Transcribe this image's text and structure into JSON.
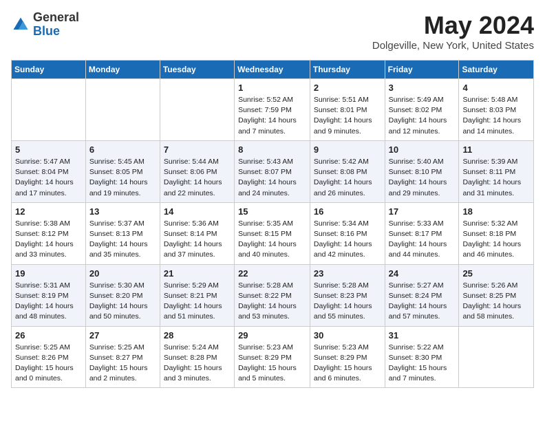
{
  "header": {
    "logo_general": "General",
    "logo_blue": "Blue",
    "month_title": "May 2024",
    "location": "Dolgeville, New York, United States"
  },
  "days_of_week": [
    "Sunday",
    "Monday",
    "Tuesday",
    "Wednesday",
    "Thursday",
    "Friday",
    "Saturday"
  ],
  "weeks": [
    [
      {
        "day": "",
        "info": ""
      },
      {
        "day": "",
        "info": ""
      },
      {
        "day": "",
        "info": ""
      },
      {
        "day": "1",
        "info": "Sunrise: 5:52 AM\nSunset: 7:59 PM\nDaylight: 14 hours\nand 7 minutes."
      },
      {
        "day": "2",
        "info": "Sunrise: 5:51 AM\nSunset: 8:01 PM\nDaylight: 14 hours\nand 9 minutes."
      },
      {
        "day": "3",
        "info": "Sunrise: 5:49 AM\nSunset: 8:02 PM\nDaylight: 14 hours\nand 12 minutes."
      },
      {
        "day": "4",
        "info": "Sunrise: 5:48 AM\nSunset: 8:03 PM\nDaylight: 14 hours\nand 14 minutes."
      }
    ],
    [
      {
        "day": "5",
        "info": "Sunrise: 5:47 AM\nSunset: 8:04 PM\nDaylight: 14 hours\nand 17 minutes."
      },
      {
        "day": "6",
        "info": "Sunrise: 5:45 AM\nSunset: 8:05 PM\nDaylight: 14 hours\nand 19 minutes."
      },
      {
        "day": "7",
        "info": "Sunrise: 5:44 AM\nSunset: 8:06 PM\nDaylight: 14 hours\nand 22 minutes."
      },
      {
        "day": "8",
        "info": "Sunrise: 5:43 AM\nSunset: 8:07 PM\nDaylight: 14 hours\nand 24 minutes."
      },
      {
        "day": "9",
        "info": "Sunrise: 5:42 AM\nSunset: 8:08 PM\nDaylight: 14 hours\nand 26 minutes."
      },
      {
        "day": "10",
        "info": "Sunrise: 5:40 AM\nSunset: 8:10 PM\nDaylight: 14 hours\nand 29 minutes."
      },
      {
        "day": "11",
        "info": "Sunrise: 5:39 AM\nSunset: 8:11 PM\nDaylight: 14 hours\nand 31 minutes."
      }
    ],
    [
      {
        "day": "12",
        "info": "Sunrise: 5:38 AM\nSunset: 8:12 PM\nDaylight: 14 hours\nand 33 minutes."
      },
      {
        "day": "13",
        "info": "Sunrise: 5:37 AM\nSunset: 8:13 PM\nDaylight: 14 hours\nand 35 minutes."
      },
      {
        "day": "14",
        "info": "Sunrise: 5:36 AM\nSunset: 8:14 PM\nDaylight: 14 hours\nand 37 minutes."
      },
      {
        "day": "15",
        "info": "Sunrise: 5:35 AM\nSunset: 8:15 PM\nDaylight: 14 hours\nand 40 minutes."
      },
      {
        "day": "16",
        "info": "Sunrise: 5:34 AM\nSunset: 8:16 PM\nDaylight: 14 hours\nand 42 minutes."
      },
      {
        "day": "17",
        "info": "Sunrise: 5:33 AM\nSunset: 8:17 PM\nDaylight: 14 hours\nand 44 minutes."
      },
      {
        "day": "18",
        "info": "Sunrise: 5:32 AM\nSunset: 8:18 PM\nDaylight: 14 hours\nand 46 minutes."
      }
    ],
    [
      {
        "day": "19",
        "info": "Sunrise: 5:31 AM\nSunset: 8:19 PM\nDaylight: 14 hours\nand 48 minutes."
      },
      {
        "day": "20",
        "info": "Sunrise: 5:30 AM\nSunset: 8:20 PM\nDaylight: 14 hours\nand 50 minutes."
      },
      {
        "day": "21",
        "info": "Sunrise: 5:29 AM\nSunset: 8:21 PM\nDaylight: 14 hours\nand 51 minutes."
      },
      {
        "day": "22",
        "info": "Sunrise: 5:28 AM\nSunset: 8:22 PM\nDaylight: 14 hours\nand 53 minutes."
      },
      {
        "day": "23",
        "info": "Sunrise: 5:28 AM\nSunset: 8:23 PM\nDaylight: 14 hours\nand 55 minutes."
      },
      {
        "day": "24",
        "info": "Sunrise: 5:27 AM\nSunset: 8:24 PM\nDaylight: 14 hours\nand 57 minutes."
      },
      {
        "day": "25",
        "info": "Sunrise: 5:26 AM\nSunset: 8:25 PM\nDaylight: 14 hours\nand 58 minutes."
      }
    ],
    [
      {
        "day": "26",
        "info": "Sunrise: 5:25 AM\nSunset: 8:26 PM\nDaylight: 15 hours\nand 0 minutes."
      },
      {
        "day": "27",
        "info": "Sunrise: 5:25 AM\nSunset: 8:27 PM\nDaylight: 15 hours\nand 2 minutes."
      },
      {
        "day": "28",
        "info": "Sunrise: 5:24 AM\nSunset: 8:28 PM\nDaylight: 15 hours\nand 3 minutes."
      },
      {
        "day": "29",
        "info": "Sunrise: 5:23 AM\nSunset: 8:29 PM\nDaylight: 15 hours\nand 5 minutes."
      },
      {
        "day": "30",
        "info": "Sunrise: 5:23 AM\nSunset: 8:29 PM\nDaylight: 15 hours\nand 6 minutes."
      },
      {
        "day": "31",
        "info": "Sunrise: 5:22 AM\nSunset: 8:30 PM\nDaylight: 15 hours\nand 7 minutes."
      },
      {
        "day": "",
        "info": ""
      }
    ]
  ]
}
